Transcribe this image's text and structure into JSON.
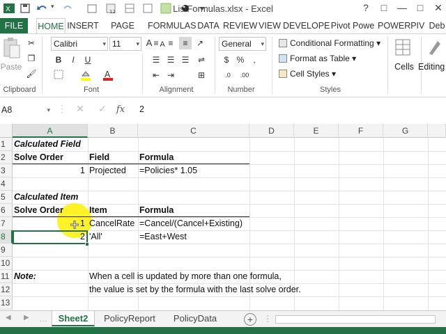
{
  "window": {
    "title": "ListFormulas.xlsx - Excel",
    "controls": [
      "?",
      "□",
      "—",
      "□",
      "✕"
    ]
  },
  "quick_access": [
    "save-icon",
    "undo-icon",
    "redo-icon",
    "open-icon",
    "calendar-icon",
    "format-icon",
    "camera-icon"
  ],
  "tabs": [
    "FILE",
    "HOME",
    "INSERT",
    "PAGE LAYO",
    "FORMULAS",
    "DATA",
    "REVIEW",
    "VIEW",
    "DEVELOPE",
    "Pivot Powe",
    "POWERPIV",
    "Deb"
  ],
  "active_tab": "HOME",
  "ribbon": {
    "clipboard": {
      "label": "Clipboard",
      "paste": "Paste"
    },
    "font": {
      "label": "Font",
      "name": "Calibri",
      "size": "11"
    },
    "alignment": {
      "label": "Alignment"
    },
    "number": {
      "label": "Number",
      "format": "General",
      "dollar": "$",
      "percent": "%",
      "comma": ",",
      "inc": ".0",
      "dec": ".00"
    },
    "styles": {
      "label": "Styles",
      "conditional": "Conditional Formatting",
      "table": "Format as Table",
      "cell": "Cell Styles"
    },
    "cells": {
      "label": "Cells"
    },
    "editing": {
      "label": "Editing"
    }
  },
  "formula_bar": {
    "name_box": "A8",
    "value": "2"
  },
  "columns": [
    "A",
    "B",
    "C",
    "D",
    "E",
    "F",
    "G"
  ],
  "rows": [
    "1",
    "2",
    "3",
    "4",
    "5",
    "6",
    "7",
    "8",
    "9",
    "10",
    "11",
    "12",
    "13"
  ],
  "cells": {
    "A1": "Calculated Field",
    "A2": "Solve Order",
    "B2": "Field",
    "C2": "Formula",
    "A3": "1",
    "B3": "Projected",
    "C3": "=Policies* 1.05",
    "A5": "Calculated Item",
    "A6": "Solve Order",
    "B6": "Item",
    "C6": "Formula",
    "A7": "1",
    "B7": "CancelRate",
    "C7": "=Cancel/(Cancel+Existing)",
    "A8": "2",
    "B8": "'All'",
    "C8": "=East+West",
    "A11": "Note:",
    "B11": "When a cell is updated by more than one formula,",
    "B12": "the value is set by the formula with the last solve order."
  },
  "sheets": [
    "Sheet2",
    "PolicyReport",
    "PolicyData"
  ],
  "active_sheet": "Sheet2",
  "colors": {
    "accent": "#217346",
    "highlight": "#fff000"
  }
}
